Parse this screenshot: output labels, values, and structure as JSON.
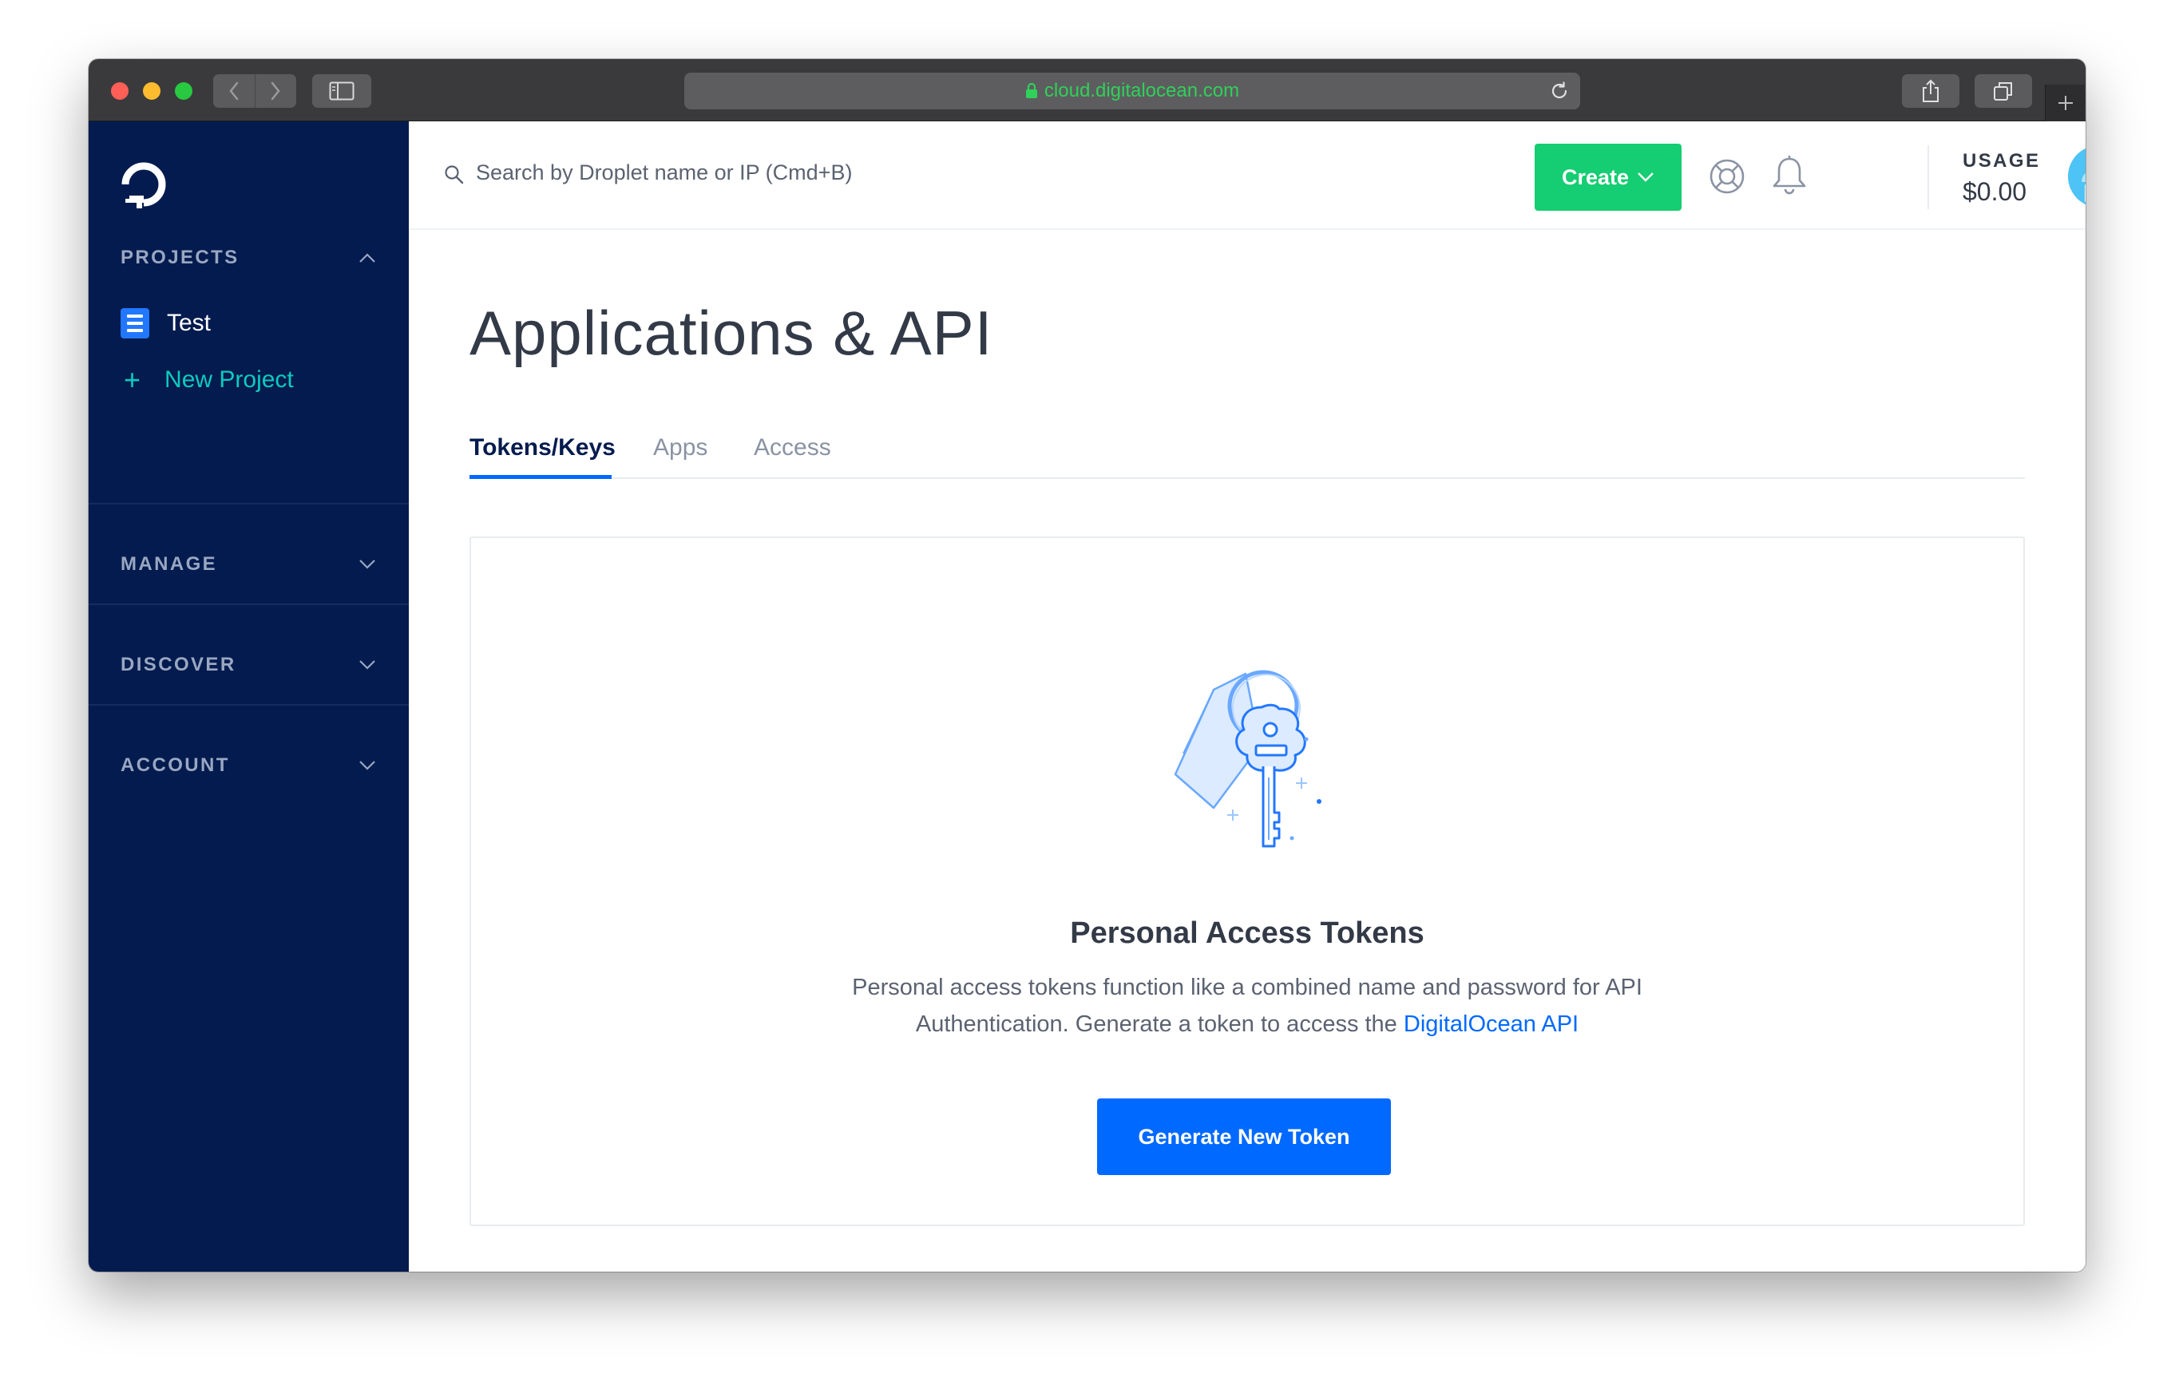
{
  "browser": {
    "url": "cloud.digitalocean.com"
  },
  "sidebar": {
    "sections": {
      "projects": "PROJECTS",
      "manage": "MANAGE",
      "discover": "DISCOVER",
      "account": "ACCOUNT"
    },
    "projects": [
      {
        "label": "Test"
      }
    ],
    "new_project_label": "New Project"
  },
  "topbar": {
    "search_placeholder": "Search by Droplet name or IP (Cmd+B)",
    "create_label": "Create",
    "usage_label": "USAGE",
    "usage_value": "$0.00"
  },
  "main": {
    "title": "Applications & API",
    "tabs": [
      {
        "label": "Tokens/Keys",
        "active": true
      },
      {
        "label": "Apps",
        "active": false
      },
      {
        "label": "Access",
        "active": false
      }
    ],
    "card": {
      "title": "Personal Access Tokens",
      "desc_line1": "Personal access tokens function like a combined name and password for API",
      "desc_line2_prefix": "Authentication. Generate a token to access the",
      "link_text": "DigitalOcean API",
      "button_label": "Generate New Token",
      "illustration_icon": "key-with-tag-icon"
    }
  },
  "colors": {
    "sidebar_bg": "#031b4e",
    "accent_blue": "#0069ff",
    "create_green": "#15cd72",
    "teal": "#0bcbbf"
  }
}
